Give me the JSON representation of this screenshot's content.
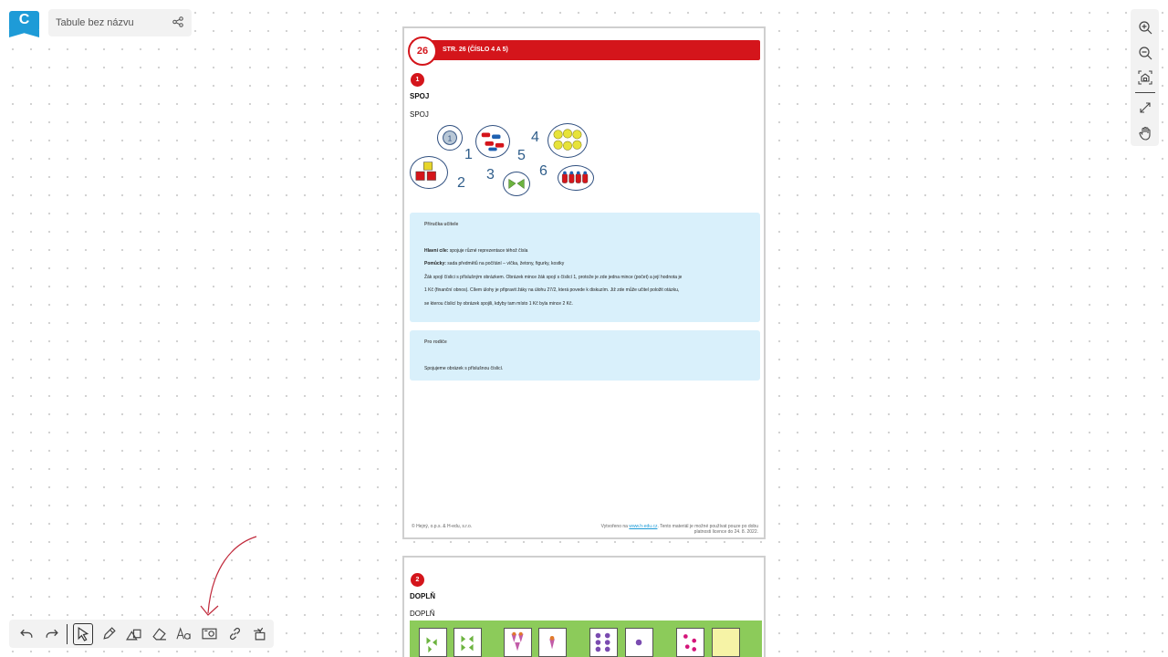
{
  "app": {
    "logo_letter": "C",
    "board_title": "Tabule bez názvu"
  },
  "colors": {
    "brand": "#1e9bd7",
    "accent_red": "#d4151b",
    "info_bg": "#d9f0fb",
    "green_strip": "#8ccb5a"
  },
  "right_toolbar": [
    "zoom-in-icon",
    "zoom-out-icon",
    "fit-to-screen-icon",
    "fullscreen-icon",
    "hand-pan-icon"
  ],
  "bottom_toolbar": [
    "undo-icon",
    "redo-icon",
    "select-pointer-icon",
    "pen-icon",
    "shapes-icon",
    "eraser-icon",
    "text-icon",
    "image-icon",
    "link-icon",
    "more-tools-icon"
  ],
  "page1": {
    "page_number": "26",
    "banner": "STR. 26 (ČÍSLO 4 A 5)",
    "task_number": "1",
    "heading": "SPOJ",
    "subheading": "SPOJ",
    "numbers": [
      "1",
      "2",
      "3",
      "4",
      "5",
      "6"
    ],
    "teacher_box": {
      "label": "Příručka učitele",
      "goal_label": "Hlavní cíle:",
      "goal_text": " spojuje různé reprezentace téhož čísla",
      "aids_label": "Pomůcky:",
      "aids_text": " sada předmětů na počítání – víčka, žetony, figurky, kostky",
      "line1": "Žák spojí číslici s příslušným obrázkem. Obrázek mince žák spojí s číslicí 1, protože je zde jedna mince (počet) a její hodnota je",
      "line2": "1 Kč (finanční obnos). Cílem úlohy je připravit žáky na úlohu 27/2, která povede k diskuzím. Již zde může učitel položit otázku,",
      "line3": "se kterou číslicí by obrázek spojili, kdyby tam místo 1 Kč byla mince 2 Kč."
    },
    "parent_box": {
      "label": "Pro rodiče",
      "text": "Spojujeme obrázek s příslušnou číslicí."
    },
    "footer_left": "© Hejný, o.p.s. & H-edu, s.r.o.",
    "footer_right_pre": "Vytvořeno na ",
    "footer_link": "www.h-edu.cz",
    "footer_right_post": ". Tento materiál je možné používat pouze po dobu",
    "footer_right_line2": "platnosti licence do 24. 8. 2022."
  },
  "page2": {
    "task_number": "2",
    "heading": "DOPLŇ",
    "subheading": "DOPLŇ"
  }
}
